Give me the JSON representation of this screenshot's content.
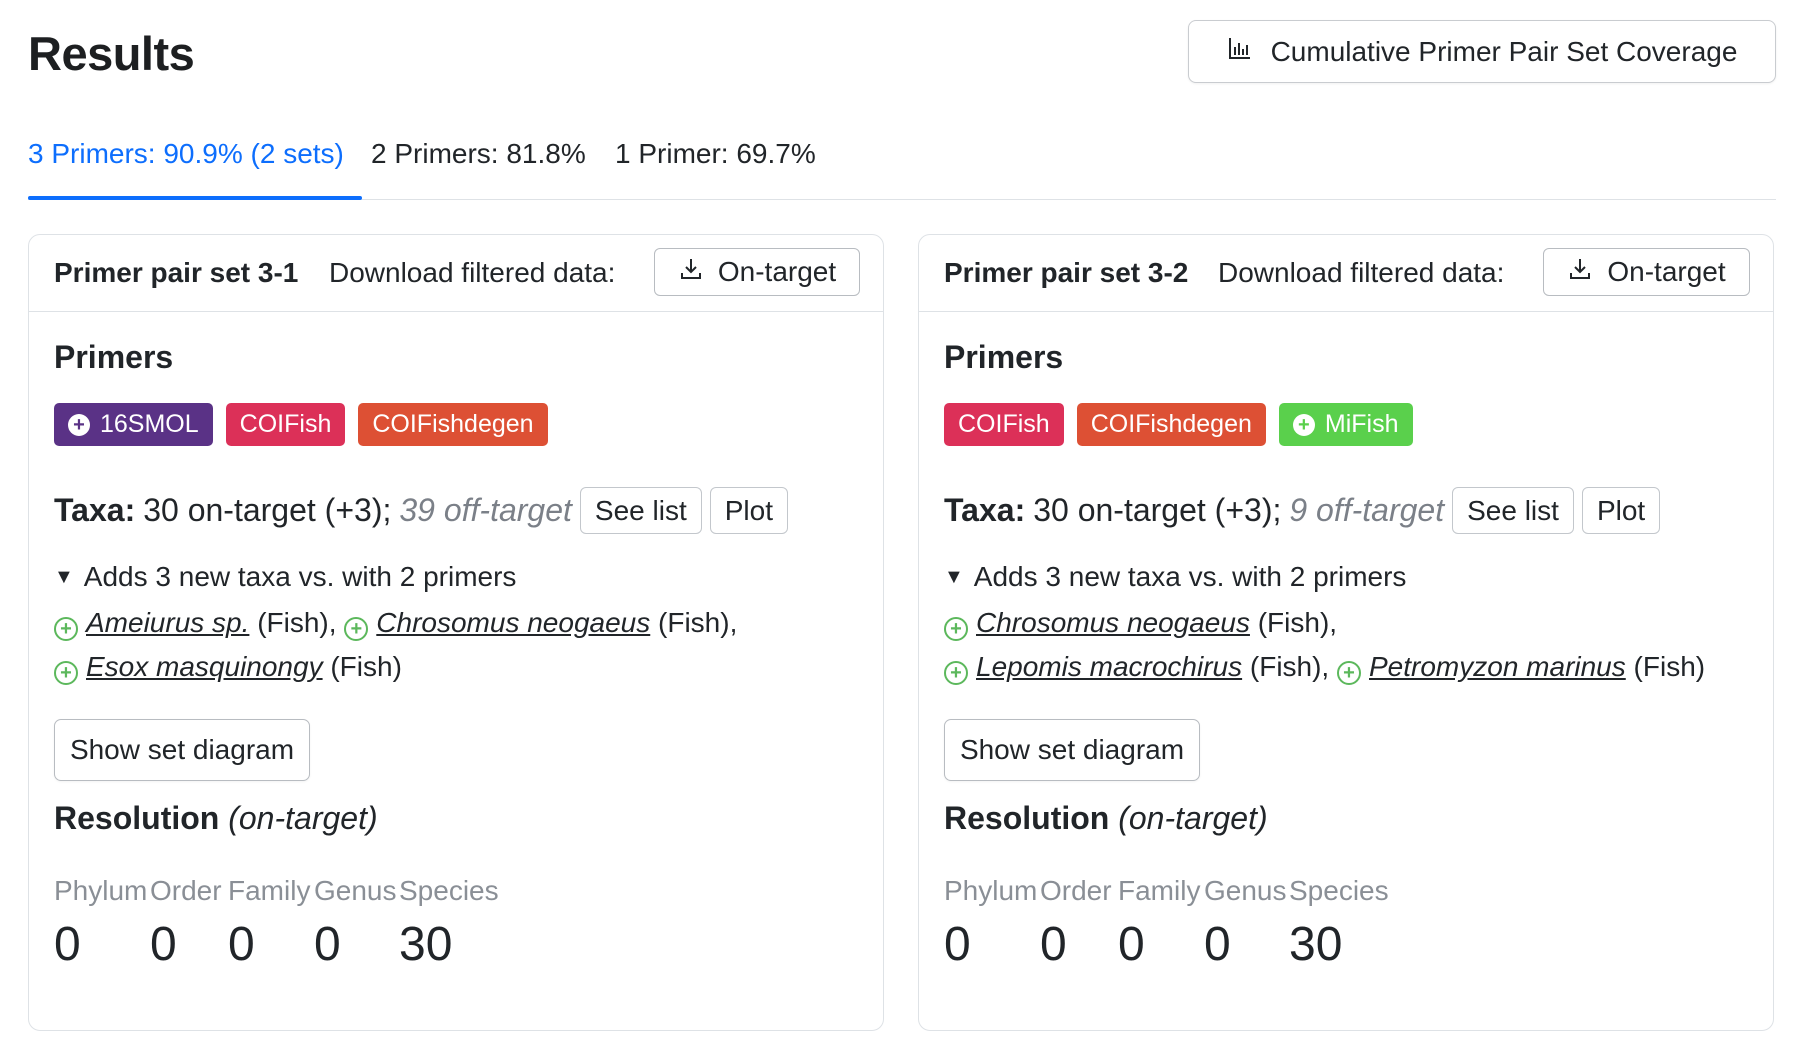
{
  "page": {
    "title": "Results"
  },
  "toolbar": {
    "coverage_label": "Cumulative Primer Pair Set Coverage",
    "coverage_icon": "bar-chart-icon"
  },
  "tabs": [
    {
      "label": "3 Primers: 90.9% (2 sets)",
      "active": true
    },
    {
      "label": "2 Primers: 81.8%",
      "active": false
    },
    {
      "label": "1 Primer: 69.7%",
      "active": false
    }
  ],
  "common": {
    "download_label": "Download filtered data:",
    "ontarget_label": "On-target",
    "primers_title": "Primers",
    "taxa_label": "Taxa:",
    "see_list_label": "See list",
    "plot_label": "Plot",
    "adds_label": "Adds 3 new taxa vs. with 2 primers",
    "show_diagram_label": "Show set diagram",
    "resolution_title": "Resolution",
    "resolution_sub": "(on-target)",
    "resolution_headers": [
      "Phylum",
      "Order",
      "Family",
      "Genus",
      "Species"
    ]
  },
  "sets": [
    {
      "title": "Primer pair set 3-1",
      "primers": [
        {
          "name": "16SMOL",
          "color": "#5a3286",
          "added": true
        },
        {
          "name": "COIFish",
          "color": "#dc3058",
          "added": false
        },
        {
          "name": "COIFishdegen",
          "color": "#dd5034",
          "added": false
        }
      ],
      "taxa_summary": "30 on-target (+3);",
      "off_target": "39 off-target",
      "new_taxa": [
        {
          "name": "Ameiurus sp.",
          "group": "(Fish),",
          "line": 0
        },
        {
          "name": "Chrosomus neogaeus",
          "group": "(Fish),",
          "line": 0
        },
        {
          "name": "Esox masquinongy",
          "group": "(Fish)",
          "line": 1
        }
      ],
      "resolution_values": [
        "0",
        "0",
        "0",
        "0",
        "30"
      ]
    },
    {
      "title": "Primer pair set 3-2",
      "primers": [
        {
          "name": "COIFish",
          "color": "#dc3058",
          "added": false
        },
        {
          "name": "COIFishdegen",
          "color": "#dd5034",
          "added": false
        },
        {
          "name": "MiFish",
          "color": "#5ad04c",
          "added": true
        }
      ],
      "taxa_summary": "30 on-target (+3);",
      "off_target": "9 off-target",
      "new_taxa": [
        {
          "name": "Chrosomus neogaeus",
          "group": "(Fish),",
          "line": 0
        },
        {
          "name": "Lepomis macrochirus",
          "group": "(Fish),",
          "line": 1
        },
        {
          "name": "Petromyzon marinus",
          "group": "(Fish)",
          "line": 1
        }
      ],
      "resolution_values": [
        "0",
        "0",
        "0",
        "0",
        "30"
      ]
    }
  ]
}
